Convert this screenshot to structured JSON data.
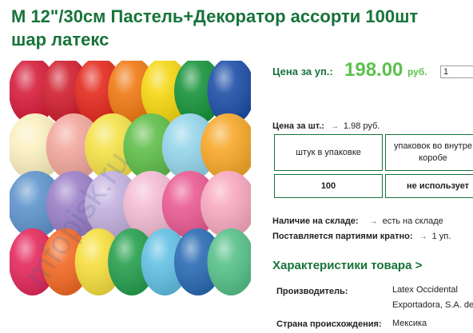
{
  "product": {
    "title_line1": "М 12\"/30см Пастель+Декоратор ассорти 100шт",
    "title_line2": "шар латекс"
  },
  "watermark": "mfopisk.ru",
  "price": {
    "label": "Цена за уп.:",
    "value": "198.00",
    "currency": "руб.",
    "qty_value": "1"
  },
  "unit_price": {
    "label": "Цена за шт.:",
    "value": "1.98 руб."
  },
  "packaging_table": {
    "headers": [
      "штук в упаковке",
      "упаковок во внутр… коробе"
    ],
    "header2_line1": "упаковок во внутре",
    "header2_line2": "коробе",
    "values": [
      "100",
      "не использует"
    ]
  },
  "stock": {
    "label": "Наличие на складе:",
    "value": "есть на складе"
  },
  "batch": {
    "label": "Поставляется партиями кратно:",
    "value": "1 уп."
  },
  "characteristics": {
    "heading": "Характеристики товара >",
    "manufacturer_label": "Производитель:",
    "manufacturer_line1": "Latex Occidental",
    "manufacturer_line2": "Exportadora, S.A. de",
    "country_label": "Страна происхождения:",
    "country_value": "Мексика"
  },
  "colors": {
    "title_green": "#17733a",
    "price_green": "#5cc14d",
    "border_green": "#17733a"
  }
}
